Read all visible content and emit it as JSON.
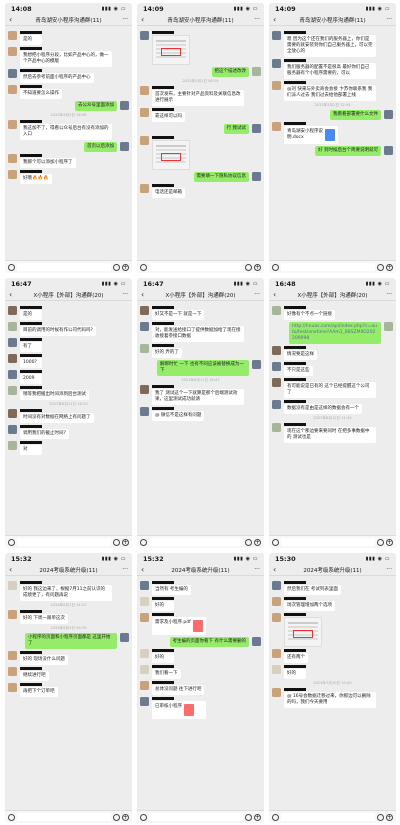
{
  "phones": [
    {
      "time": "14:08",
      "title": "青岛湖安小程序沟通群(11)",
      "messages": [
        {
          "type": "text",
          "text": "是的",
          "avatar": "a1"
        },
        {
          "type": "text",
          "text": "我想把小程序分段，比如产品中心的，做一个产品中心的模版",
          "avatar": "a1"
        },
        {
          "type": "text",
          "text": "然后去参考前面小程序的产品中心",
          "avatar": "a2"
        },
        {
          "type": "text",
          "text": "不知道要怎么操作",
          "avatar": "a1"
        },
        {
          "type": "text",
          "text": "去公众号里面添加",
          "avatar": "a2",
          "me": true
        },
        {
          "type": "time",
          "text": "2022年5月2日 16:08"
        },
        {
          "type": "text",
          "text": "我这加不了，得看公众号后台有没有添加的入口",
          "avatar": "a1"
        },
        {
          "type": "text",
          "text": "首页以后添加",
          "avatar": "a2",
          "me": true
        },
        {
          "type": "text",
          "text": "我那个可以添加小程序了",
          "avatar": "a1"
        },
        {
          "type": "text",
          "text": "好哦🔥🔥🔥",
          "avatar": "a1"
        }
      ]
    },
    {
      "time": "14:09",
      "title": "青岛湖安小程序沟通群(11)",
      "messages": [
        {
          "type": "image",
          "avatar": "a2"
        },
        {
          "type": "text",
          "text": "把这个描述改改",
          "avatar": "a3",
          "me": true
        },
        {
          "type": "time",
          "text": "2022年5月2日 08:14"
        },
        {
          "type": "text",
          "text": "首次发布，主要针对产品资料及关联信息改进行展示",
          "avatar": "a1"
        },
        {
          "type": "text",
          "text": "靠这样可以吗",
          "avatar": "a1"
        },
        {
          "type": "text",
          "text": "行 我试试",
          "avatar": "a2",
          "me": true
        },
        {
          "type": "image",
          "avatar": "a1"
        },
        {
          "type": "text",
          "text": "需要填一下隐私协议信息",
          "avatar": "a2",
          "me": true
        },
        {
          "type": "text",
          "text": "电话还是邮箱",
          "avatar": "a1"
        }
      ]
    },
    {
      "time": "14:09",
      "title": "青岛湖安小程序沟通群(11)",
      "messages": [
        {
          "type": "text",
          "text": "嗯 因为这个还在我们的服务器上，你们是需要的就安装到你们自己服务器上，可以完全放心的",
          "avatar": "a2"
        },
        {
          "type": "text",
          "text": "我们服务器的配置不是很高 最好你们自己服务器有个小程序需要的，可以",
          "avatar": "a2"
        },
        {
          "type": "text",
          "text": "@刘 快来与外卖商会会接 卞苏你联系我 我们派人过去 我们过去给他部署上线",
          "avatar": "a1"
        },
        {
          "type": "time",
          "text": "2022年5月2日 12:54"
        },
        {
          "type": "text",
          "text": "我看看部署要什么文件",
          "avatar": "a2",
          "me": true
        },
        {
          "type": "file",
          "text": "青岛湖安小程序说明.docx",
          "avatar": "a1"
        },
        {
          "type": "text",
          "text": "好 到时候后台个简要说明就可",
          "avatar": "a2",
          "me": true
        }
      ]
    },
    {
      "time": "16:47",
      "title": "X小程序【外部】沟通群(20)",
      "messages": [
        {
          "type": "text",
          "text": "是的",
          "avatar": "a4"
        },
        {
          "type": "text",
          "text": "目前的调用的时候有作公司代码吗?",
          "avatar": "a3"
        },
        {
          "type": "text",
          "text": "有了",
          "avatar": "a2",
          "me": false
        },
        {
          "type": "text",
          "text": "1000?",
          "avatar": "a4"
        },
        {
          "type": "text",
          "text": "2009",
          "avatar": "a2"
        },
        {
          "type": "text",
          "text": "稍等我把搬出时间添到后台测试",
          "avatar": "a3"
        },
        {
          "type": "time",
          "text": "2022年8月11日 16:23"
        },
        {
          "type": "text",
          "text": "时间没有对数据在网络上有问题了",
          "avatar": "a4"
        },
        {
          "type": "text",
          "text": "调用我们的截止时间?",
          "avatar": "a2"
        },
        {
          "type": "text",
          "text": "对",
          "avatar": "a3"
        }
      ]
    },
    {
      "time": "16:47",
      "title": "X小程序【外部】沟通群(20)",
      "messages": [
        {
          "type": "text",
          "text": "好又不是一下 就是一下",
          "avatar": "a4"
        },
        {
          "type": "text",
          "text": "对，能发送给接口了提供数据加给了现在接收接着参接口数据",
          "avatar": "a2"
        },
        {
          "type": "text",
          "text": "好的 弄的了",
          "avatar": "a3"
        },
        {
          "type": "text",
          "text": "解绑时忙 一下 也有不同应该被替换成为一下",
          "avatar": "a2",
          "me": true
        },
        {
          "type": "time",
          "text": "2022年8月11日 16:47"
        },
        {
          "type": "text",
          "text": "我了 测试这个一下就算是那个后端测试效果，这里测试成功就请",
          "avatar": "a4"
        },
        {
          "type": "text",
          "text": "@ 微信不是这样有问题",
          "avatar": "a2"
        }
      ]
    },
    {
      "time": "16:48",
      "title": "X小程序【外部】沟通群(20)",
      "messages": [
        {
          "type": "text",
          "text": "好像有个不点一个链接",
          "avatar": "a3"
        },
        {
          "type": "link",
          "text": "http://hnuas.com/api/index.php?c=auto/test/onetime?AAm1_88SZMXO202209098",
          "avatar": "a3",
          "me": true
        },
        {
          "type": "text",
          "text": "情况要是这样",
          "avatar": "a4"
        },
        {
          "type": "text",
          "text": "不只是这些",
          "avatar": "a2"
        },
        {
          "type": "text",
          "text": "有可能说是已有的 这个已经提醒这个公司了",
          "avatar": "a4"
        },
        {
          "type": "text",
          "text": "数据没有是由是这样的数据会有一个",
          "avatar": "a2"
        },
        {
          "type": "time",
          "text": "2022年8月12日 11:34"
        },
        {
          "type": "text",
          "text": "现在这个那边要来要同时 在把多事数据中的 测试也是",
          "avatar": "a3"
        }
      ]
    },
    {
      "time": "15:32",
      "title": "2024考级系统升级(11)",
      "messages": [
        {
          "type": "text",
          "text": "好的 我这边来了，根据7月11之前认识的成绩更了，有问题再说",
          "avatar": "a5"
        },
        {
          "type": "time",
          "text": "2024年6月1日 14:23"
        },
        {
          "type": "text",
          "text": "好的 下周一跟单这次",
          "avatar": "a1"
        },
        {
          "type": "time",
          "text": "2024年6月3日 09:29"
        },
        {
          "type": "text",
          "text": "小程序的页面和小程序页面都是 这里开始了",
          "avatar": "a2",
          "me": true
        },
        {
          "type": "text",
          "text": "好的 现场没什么问题",
          "avatar": "a1"
        },
        {
          "type": "text",
          "text": "继续进行吧",
          "avatar": "a1"
        },
        {
          "type": "text",
          "text": "再把下个订单吧",
          "avatar": "a1"
        }
      ]
    },
    {
      "time": "15:32",
      "title": "2024考级系统升级(11)",
      "messages": [
        {
          "type": "text",
          "text": "当然有 考生编的",
          "avatar": "a2"
        },
        {
          "type": "text",
          "text": "好的",
          "avatar": "a5"
        },
        {
          "type": "file",
          "text": "需求及小程序.pdf",
          "avatar": "a1"
        },
        {
          "type": "text",
          "text": "考生编的页面你看下 有什么需要删的",
          "avatar": "a2",
          "me": true
        },
        {
          "type": "text",
          "text": "好的",
          "avatar": "a5"
        },
        {
          "type": "text",
          "text": "我们看一下",
          "avatar": "a5"
        },
        {
          "type": "text",
          "text": "总体没问题 往下进行吧",
          "avatar": "a1"
        },
        {
          "type": "file",
          "text": "已审核小程序",
          "avatar": "a2"
        }
      ]
    },
    {
      "time": "15:30",
      "title": "2024考级系统升级(11)",
      "messages": [
        {
          "type": "text",
          "text": "然后我们在 考试列表里面",
          "avatar": "a2"
        },
        {
          "type": "text",
          "text": "场次管理增加两个选项",
          "avatar": "a1"
        },
        {
          "type": "image",
          "avatar": "a1"
        },
        {
          "type": "text",
          "text": "还有两个",
          "avatar": "a1"
        },
        {
          "type": "text",
          "text": "好的",
          "avatar": "a5"
        },
        {
          "type": "time",
          "text": "2024年7月10日 10:40"
        },
        {
          "type": "text",
          "text": "@ 16号会数据迁移过来，你那边可以删除的吗，我们今天要用",
          "avatar": "a1"
        }
      ]
    }
  ]
}
